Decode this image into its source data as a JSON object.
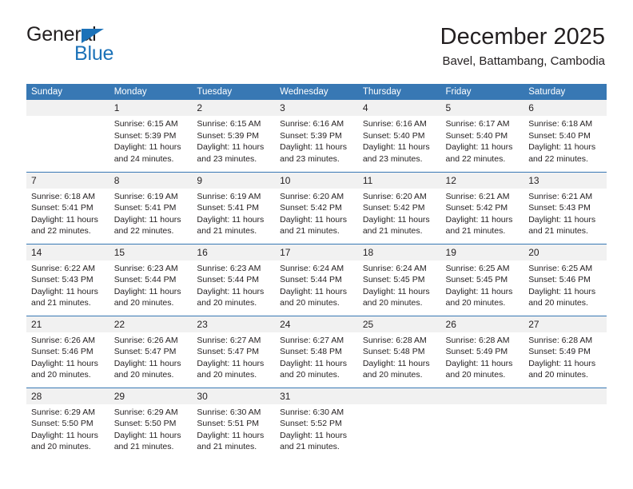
{
  "brand": {
    "name_top": "General",
    "name_bottom": "Blue",
    "triangle_color": "#1c72b8"
  },
  "header": {
    "title": "December 2025",
    "subtitle": "Bavel, Battambang, Cambodia"
  },
  "theme": {
    "header_blue": "#3878b4",
    "daynum_band": "#f1f1f1",
    "text": "#231f20"
  },
  "calendar": {
    "weekday_headers": [
      "Sunday",
      "Monday",
      "Tuesday",
      "Wednesday",
      "Thursday",
      "Friday",
      "Saturday"
    ],
    "labels": {
      "sunrise_prefix": "Sunrise: ",
      "sunset_prefix": "Sunset: ",
      "daylight_prefix": "Daylight: "
    },
    "weeks": [
      [
        {
          "day": "",
          "sunrise": "",
          "sunset": "",
          "daylight_line1": "",
          "daylight_line2": ""
        },
        {
          "day": "1",
          "sunrise": "Sunrise: 6:15 AM",
          "sunset": "Sunset: 5:39 PM",
          "daylight_line1": "Daylight: 11 hours",
          "daylight_line2": "and 24 minutes."
        },
        {
          "day": "2",
          "sunrise": "Sunrise: 6:15 AM",
          "sunset": "Sunset: 5:39 PM",
          "daylight_line1": "Daylight: 11 hours",
          "daylight_line2": "and 23 minutes."
        },
        {
          "day": "3",
          "sunrise": "Sunrise: 6:16 AM",
          "sunset": "Sunset: 5:39 PM",
          "daylight_line1": "Daylight: 11 hours",
          "daylight_line2": "and 23 minutes."
        },
        {
          "day": "4",
          "sunrise": "Sunrise: 6:16 AM",
          "sunset": "Sunset: 5:40 PM",
          "daylight_line1": "Daylight: 11 hours",
          "daylight_line2": "and 23 minutes."
        },
        {
          "day": "5",
          "sunrise": "Sunrise: 6:17 AM",
          "sunset": "Sunset: 5:40 PM",
          "daylight_line1": "Daylight: 11 hours",
          "daylight_line2": "and 22 minutes."
        },
        {
          "day": "6",
          "sunrise": "Sunrise: 6:18 AM",
          "sunset": "Sunset: 5:40 PM",
          "daylight_line1": "Daylight: 11 hours",
          "daylight_line2": "and 22 minutes."
        }
      ],
      [
        {
          "day": "7",
          "sunrise": "Sunrise: 6:18 AM",
          "sunset": "Sunset: 5:41 PM",
          "daylight_line1": "Daylight: 11 hours",
          "daylight_line2": "and 22 minutes."
        },
        {
          "day": "8",
          "sunrise": "Sunrise: 6:19 AM",
          "sunset": "Sunset: 5:41 PM",
          "daylight_line1": "Daylight: 11 hours",
          "daylight_line2": "and 22 minutes."
        },
        {
          "day": "9",
          "sunrise": "Sunrise: 6:19 AM",
          "sunset": "Sunset: 5:41 PM",
          "daylight_line1": "Daylight: 11 hours",
          "daylight_line2": "and 21 minutes."
        },
        {
          "day": "10",
          "sunrise": "Sunrise: 6:20 AM",
          "sunset": "Sunset: 5:42 PM",
          "daylight_line1": "Daylight: 11 hours",
          "daylight_line2": "and 21 minutes."
        },
        {
          "day": "11",
          "sunrise": "Sunrise: 6:20 AM",
          "sunset": "Sunset: 5:42 PM",
          "daylight_line1": "Daylight: 11 hours",
          "daylight_line2": "and 21 minutes."
        },
        {
          "day": "12",
          "sunrise": "Sunrise: 6:21 AM",
          "sunset": "Sunset: 5:42 PM",
          "daylight_line1": "Daylight: 11 hours",
          "daylight_line2": "and 21 minutes."
        },
        {
          "day": "13",
          "sunrise": "Sunrise: 6:21 AM",
          "sunset": "Sunset: 5:43 PM",
          "daylight_line1": "Daylight: 11 hours",
          "daylight_line2": "and 21 minutes."
        }
      ],
      [
        {
          "day": "14",
          "sunrise": "Sunrise: 6:22 AM",
          "sunset": "Sunset: 5:43 PM",
          "daylight_line1": "Daylight: 11 hours",
          "daylight_line2": "and 21 minutes."
        },
        {
          "day": "15",
          "sunrise": "Sunrise: 6:23 AM",
          "sunset": "Sunset: 5:44 PM",
          "daylight_line1": "Daylight: 11 hours",
          "daylight_line2": "and 20 minutes."
        },
        {
          "day": "16",
          "sunrise": "Sunrise: 6:23 AM",
          "sunset": "Sunset: 5:44 PM",
          "daylight_line1": "Daylight: 11 hours",
          "daylight_line2": "and 20 minutes."
        },
        {
          "day": "17",
          "sunrise": "Sunrise: 6:24 AM",
          "sunset": "Sunset: 5:44 PM",
          "daylight_line1": "Daylight: 11 hours",
          "daylight_line2": "and 20 minutes."
        },
        {
          "day": "18",
          "sunrise": "Sunrise: 6:24 AM",
          "sunset": "Sunset: 5:45 PM",
          "daylight_line1": "Daylight: 11 hours",
          "daylight_line2": "and 20 minutes."
        },
        {
          "day": "19",
          "sunrise": "Sunrise: 6:25 AM",
          "sunset": "Sunset: 5:45 PM",
          "daylight_line1": "Daylight: 11 hours",
          "daylight_line2": "and 20 minutes."
        },
        {
          "day": "20",
          "sunrise": "Sunrise: 6:25 AM",
          "sunset": "Sunset: 5:46 PM",
          "daylight_line1": "Daylight: 11 hours",
          "daylight_line2": "and 20 minutes."
        }
      ],
      [
        {
          "day": "21",
          "sunrise": "Sunrise: 6:26 AM",
          "sunset": "Sunset: 5:46 PM",
          "daylight_line1": "Daylight: 11 hours",
          "daylight_line2": "and 20 minutes."
        },
        {
          "day": "22",
          "sunrise": "Sunrise: 6:26 AM",
          "sunset": "Sunset: 5:47 PM",
          "daylight_line1": "Daylight: 11 hours",
          "daylight_line2": "and 20 minutes."
        },
        {
          "day": "23",
          "sunrise": "Sunrise: 6:27 AM",
          "sunset": "Sunset: 5:47 PM",
          "daylight_line1": "Daylight: 11 hours",
          "daylight_line2": "and 20 minutes."
        },
        {
          "day": "24",
          "sunrise": "Sunrise: 6:27 AM",
          "sunset": "Sunset: 5:48 PM",
          "daylight_line1": "Daylight: 11 hours",
          "daylight_line2": "and 20 minutes."
        },
        {
          "day": "25",
          "sunrise": "Sunrise: 6:28 AM",
          "sunset": "Sunset: 5:48 PM",
          "daylight_line1": "Daylight: 11 hours",
          "daylight_line2": "and 20 minutes."
        },
        {
          "day": "26",
          "sunrise": "Sunrise: 6:28 AM",
          "sunset": "Sunset: 5:49 PM",
          "daylight_line1": "Daylight: 11 hours",
          "daylight_line2": "and 20 minutes."
        },
        {
          "day": "27",
          "sunrise": "Sunrise: 6:28 AM",
          "sunset": "Sunset: 5:49 PM",
          "daylight_line1": "Daylight: 11 hours",
          "daylight_line2": "and 20 minutes."
        }
      ],
      [
        {
          "day": "28",
          "sunrise": "Sunrise: 6:29 AM",
          "sunset": "Sunset: 5:50 PM",
          "daylight_line1": "Daylight: 11 hours",
          "daylight_line2": "and 20 minutes."
        },
        {
          "day": "29",
          "sunrise": "Sunrise: 6:29 AM",
          "sunset": "Sunset: 5:50 PM",
          "daylight_line1": "Daylight: 11 hours",
          "daylight_line2": "and 21 minutes."
        },
        {
          "day": "30",
          "sunrise": "Sunrise: 6:30 AM",
          "sunset": "Sunset: 5:51 PM",
          "daylight_line1": "Daylight: 11 hours",
          "daylight_line2": "and 21 minutes."
        },
        {
          "day": "31",
          "sunrise": "Sunrise: 6:30 AM",
          "sunset": "Sunset: 5:52 PM",
          "daylight_line1": "Daylight: 11 hours",
          "daylight_line2": "and 21 minutes."
        },
        {
          "day": "",
          "sunrise": "",
          "sunset": "",
          "daylight_line1": "",
          "daylight_line2": ""
        },
        {
          "day": "",
          "sunrise": "",
          "sunset": "",
          "daylight_line1": "",
          "daylight_line2": ""
        },
        {
          "day": "",
          "sunrise": "",
          "sunset": "",
          "daylight_line1": "",
          "daylight_line2": ""
        }
      ]
    ]
  }
}
